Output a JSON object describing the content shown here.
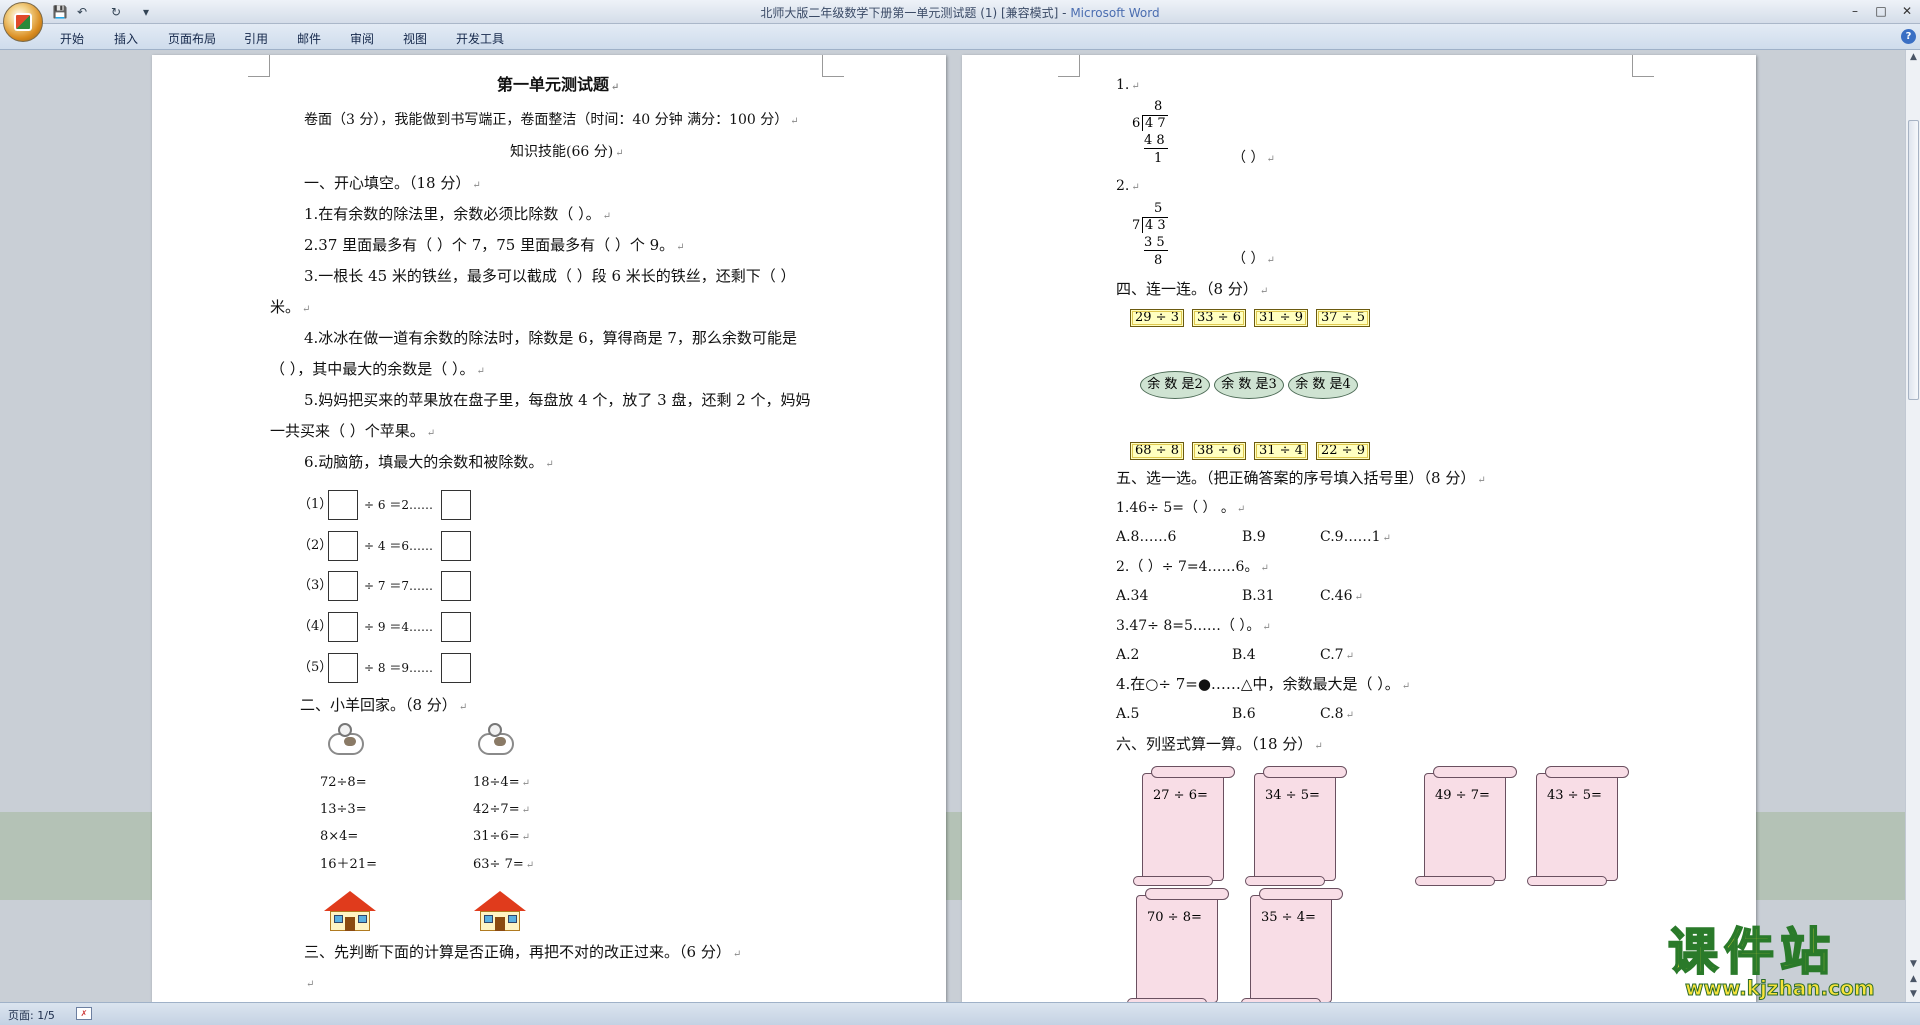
{
  "window": {
    "title": "北师大版二年级数学下册第一单元测试题 (1) [兼容模式] - ",
    "app": "Microsoft Word"
  },
  "ribbon": {
    "tabs": [
      "开始",
      "插入",
      "页面布局",
      "引用",
      "邮件",
      "审阅",
      "视图",
      "开发工具"
    ]
  },
  "status": {
    "page": "页面: 1/5"
  },
  "page1": {
    "title": "第一单元测试题",
    "header": "卷面（3 分），我能做到书写端正，卷面整洁（时间：40 分钟  满分：100 分）",
    "subhead": "知识技能(66 分)",
    "s1": "一、开心填空。（18 分）",
    "q1": "1.在有余数的除法里，余数必须比除数（      ）。",
    "q2": "2.37 里面最多有（      ）个 7，75 里面最多有（      ）个 9。",
    "q3a": "3.一根长 45 米的铁丝，最多可以截成（      ）段 6 米长的铁丝，还剩下（      ）",
    "q3b": "米。",
    "q4a": "4.冰冰在做一道有余数的除法时，除数是  6，算得商是  7，那么余数可能是",
    "q4b": "（      ），其中最大的余数是（      ）。",
    "q5a": "5.妈妈把买来的苹果放在盘子里，每盘放 4 个，放了 3 盘，还剩 2 个，妈妈",
    "q5b": "一共买来（      ）个苹果。",
    "q6": "6.动脑筋，填最大的余数和被除数。",
    "blanks": [
      {
        "n": "（1）",
        "op": "÷ 6 ＝2……"
      },
      {
        "n": "（2）",
        "op": "÷ 4 ＝6……"
      },
      {
        "n": "（3）",
        "op": "÷ 7 ＝7……"
      },
      {
        "n": "（4）",
        "op": "÷ 9 ＝4……"
      },
      {
        "n": "（5）",
        "op": "÷ 8 ＝9……"
      }
    ],
    "s2": "二、小羊回家。（8 分）",
    "sheepL": [
      "72÷8=",
      "13÷3=",
      "8×4=",
      "16＋21="
    ],
    "sheepR": [
      "18÷4=",
      "42÷7=",
      "31÷6=",
      "63÷ 7="
    ],
    "s3": "三、先判断下面的计算是否正确，再把不对的改正过来。（6 分）"
  },
  "page2": {
    "ld1": {
      "n": "1.",
      "q": "8",
      "d": "6",
      "dd": "4 7",
      "p": "4 8",
      "r": "1",
      "paren": "（      ）"
    },
    "ld2": {
      "n": "2.",
      "q": "5",
      "d": "7",
      "dd": "4 3",
      "p": "3 5",
      "r": "8",
      "paren": "（      ）"
    },
    "s4": "四、连一连。（8 分）",
    "top": [
      "29 ÷ 3",
      "33 ÷ 6",
      "31 ÷ 9",
      "37 ÷ 5"
    ],
    "ovals": [
      "余 数 是2",
      "余 数 是3",
      "余 数 是4"
    ],
    "bottom": [
      "68 ÷ 8",
      "38 ÷ 6",
      "31 ÷ 4",
      "22 ÷ 9"
    ],
    "s5": "五、选一选。（把正确答案的序号填入括号里）（8 分）",
    "m1": "1.46÷ 5=（     ）      。",
    "m1o": [
      "A.8……6",
      "B.9",
      "C.9……1"
    ],
    "m2": "2.（      ）÷ 7=4……6。",
    "m2o": [
      "A.34",
      "B.31",
      "C.46"
    ],
    "m3": "3.47÷ 8=5……（      ）。",
    "m3o": [
      "A.2",
      "B.4",
      "C.7"
    ],
    "m4": "4.在○÷ 7=●……△中，余数最大是（      ）。",
    "m4o": [
      "A.5",
      "B.6",
      "C.8"
    ],
    "s6": "六、列竖式算一算。（18 分）",
    "scrolls": [
      "27 ÷ 6=",
      "34 ÷ 5=",
      "49 ÷ 7=",
      "43 ÷ 5=",
      "70 ÷ 8=",
      "35 ÷ 4="
    ]
  },
  "watermark": {
    "main": "课件站",
    "url": "www.kjzhan.com"
  }
}
